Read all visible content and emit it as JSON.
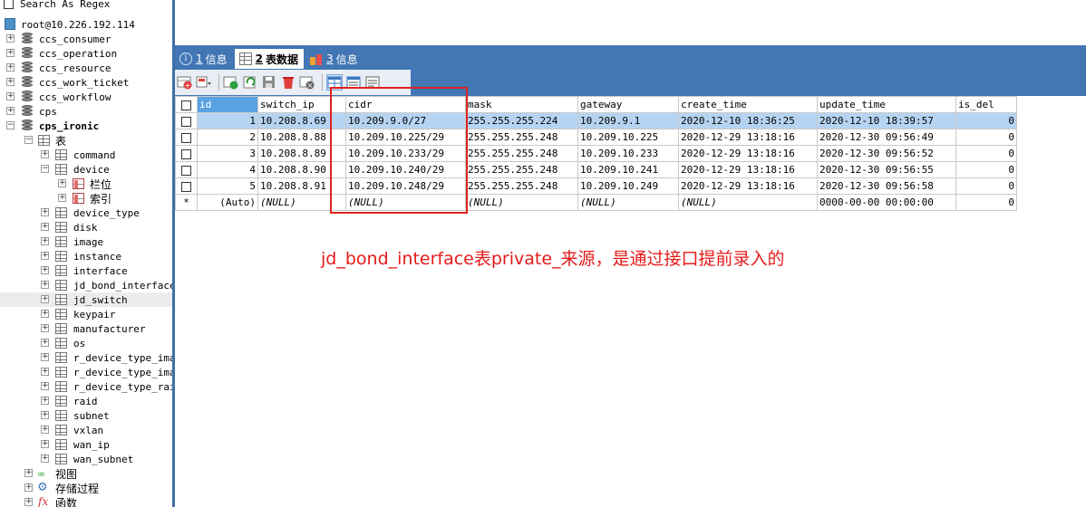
{
  "tree": {
    "search_label": "Search As Regex",
    "connection": "root@10.226.192.114",
    "databases": [
      "ccs_consumer",
      "ccs_operation",
      "ccs_resource",
      "ccs_work_ticket",
      "ccs_workflow",
      "cps",
      "cps_ironic"
    ],
    "tables_folder": "表",
    "tables": [
      "command",
      "device"
    ],
    "device_children": [
      "栏位",
      "索引"
    ],
    "tables_after": [
      "device_type",
      "disk",
      "image",
      "instance",
      "interface",
      "jd_bond_interface",
      "jd_switch",
      "keypair",
      "manufacturer",
      "os",
      "r_device_type_imag",
      "r_device_type_imag",
      "r_device_type_raid",
      "raid",
      "subnet",
      "vxlan",
      "wan_ip",
      "wan_subnet"
    ],
    "selected_table": "jd_switch",
    "folders_bottom": [
      "视图",
      "存储过程",
      "函数"
    ]
  },
  "tabs": [
    {
      "num": "1",
      "label": "信息"
    },
    {
      "num": "2",
      "label": "表数据"
    },
    {
      "num": "3",
      "label": "信息"
    }
  ],
  "grid": {
    "columns": [
      "id",
      "switch_ip",
      "cidr",
      "mask",
      "gateway",
      "create_time",
      "update_time",
      "is_del"
    ],
    "rows": [
      [
        "1",
        "10.208.8.69",
        "10.209.9.0/27",
        "255.255.255.224",
        "10.209.9.1",
        "2020-12-10 18:36:25",
        "2020-12-10 18:39:57",
        "0"
      ],
      [
        "2",
        "10.208.8.88",
        "10.209.10.225/29",
        "255.255.255.248",
        "10.209.10.225",
        "2020-12-29 13:18:16",
        "2020-12-30 09:56:49",
        "0"
      ],
      [
        "3",
        "10.208.8.89",
        "10.209.10.233/29",
        "255.255.255.248",
        "10.209.10.233",
        "2020-12-29 13:18:16",
        "2020-12-30 09:56:52",
        "0"
      ],
      [
        "4",
        "10.208.8.90",
        "10.209.10.240/29",
        "255.255.255.248",
        "10.209.10.241",
        "2020-12-29 13:18:16",
        "2020-12-30 09:56:55",
        "0"
      ],
      [
        "5",
        "10.208.8.91",
        "10.209.10.248/29",
        "255.255.255.248",
        "10.209.10.249",
        "2020-12-29 13:18:16",
        "2020-12-30 09:56:58",
        "0"
      ]
    ],
    "new_row": [
      "*",
      "(Auto)",
      "(NULL)",
      "(NULL)",
      "(NULL)",
      "(NULL)",
      "(NULL)",
      "0000-00-00 00:00:00",
      "0"
    ]
  },
  "annotation": "jd_bond_interface表private_来源，是通过接口提前录入的",
  "colors": {
    "accent": "#4276b4",
    "header_selected": "#5ba2e2",
    "row_selected": "#b6d4f2",
    "annotation": "#e61a1a"
  }
}
